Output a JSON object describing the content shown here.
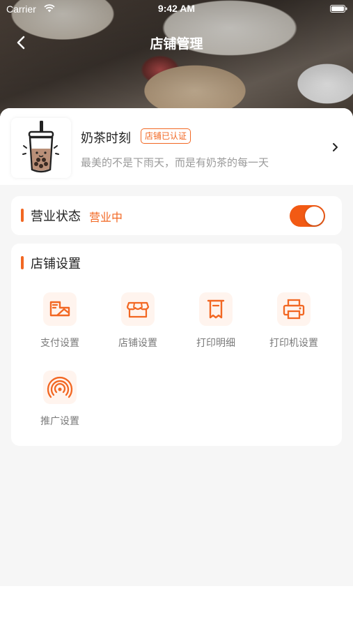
{
  "status_bar": {
    "carrier": "Carrier",
    "time": "9:42 AM"
  },
  "nav": {
    "title": "店铺管理",
    "back_icon": "chevron-left-icon"
  },
  "shop": {
    "name": "奶茶时刻",
    "badge": "店铺已认证",
    "slogan": "最美的不是下雨天，而是有奶茶的每一天",
    "logo_icon": "bubble-tea-icon"
  },
  "business_status": {
    "title": "营业状态",
    "value": "营业中",
    "toggle_on": true
  },
  "settings": {
    "title": "店铺设置",
    "items": [
      {
        "label": "支付设置",
        "icon": "payment-icon"
      },
      {
        "label": "店铺设置",
        "icon": "store-icon"
      },
      {
        "label": "打印明细",
        "icon": "receipt-icon"
      },
      {
        "label": "打印机设置",
        "icon": "printer-icon"
      },
      {
        "label": "推广设置",
        "icon": "broadcast-icon"
      }
    ]
  },
  "colors": {
    "accent": "#f26722",
    "toggle_on": "#f25a14",
    "icon_bg": "#fff4ee"
  }
}
